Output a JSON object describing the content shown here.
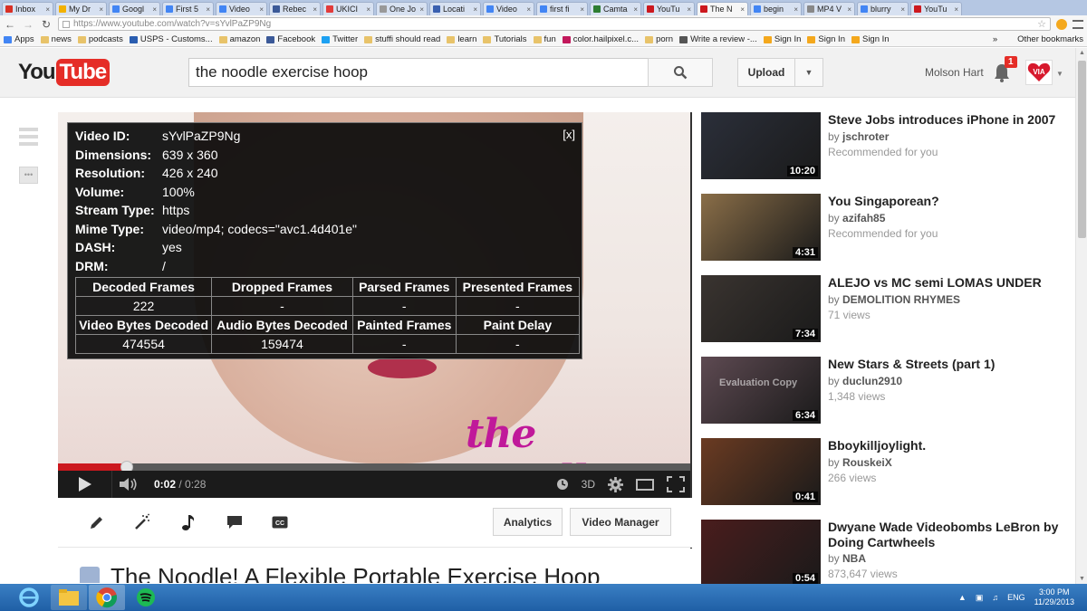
{
  "browser": {
    "tabs": [
      {
        "label": "Inbox",
        "color": "#d93025"
      },
      {
        "label": "My Dr",
        "color": "#f2b100"
      },
      {
        "label": "Googl",
        "color": "#4285f4"
      },
      {
        "label": "First 5",
        "color": "#4285f4"
      },
      {
        "label": "Video",
        "color": "#4285f4"
      },
      {
        "label": "Rebec",
        "color": "#3b5998"
      },
      {
        "label": "UKICI",
        "color": "#e23b3b"
      },
      {
        "label": "One Jo",
        "color": "#999999"
      },
      {
        "label": "Locati",
        "color": "#3a60b0"
      },
      {
        "label": "Video",
        "color": "#4285f4"
      },
      {
        "label": "first fi",
        "color": "#4285f4"
      },
      {
        "label": "Camta",
        "color": "#2e7d32"
      },
      {
        "label": "YouTu",
        "color": "#cc181e"
      },
      {
        "label": "The N",
        "color": "#cc181e",
        "active": true
      },
      {
        "label": "begin",
        "color": "#4285f4"
      },
      {
        "label": "MP4 V",
        "color": "#888888"
      },
      {
        "label": "blurry",
        "color": "#4285f4"
      },
      {
        "label": "YouTu",
        "color": "#cc181e"
      }
    ],
    "url": "https://www.youtube.com/watch?v=sYvlPaZP9Ng",
    "bookmarks": [
      "Apps",
      "news",
      "podcasts",
      "USPS - Customs...",
      "amazon",
      "Facebook",
      "Twitter",
      "stuffi should read",
      "learn",
      "Tutorials",
      "fun",
      "color.hailpixel.c...",
      "porn",
      "Write a review -...",
      "Sign In",
      "Sign In",
      "Sign In"
    ],
    "other_bookmarks": "Other bookmarks"
  },
  "header": {
    "logo_you": "You",
    "logo_tube": "Tube",
    "search_value": "the noodle exercise hoop",
    "upload_label": "Upload",
    "user_name": "Molson Hart",
    "notification_count": "1",
    "avatar_text": "VIA"
  },
  "player": {
    "current_time": "0:02",
    "duration": "/ 0:28",
    "progress_fraction": 0.108,
    "three_d_label": "3D",
    "watermark": "the noodle!"
  },
  "stats": {
    "close_label": "[x]",
    "rows": [
      {
        "k": "Video ID:",
        "v": "sYvlPaZP9Ng"
      },
      {
        "k": "Dimensions:",
        "v": "639 x 360"
      },
      {
        "k": "Resolution:",
        "v": "426 x 240"
      },
      {
        "k": "Volume:",
        "v": "100%"
      },
      {
        "k": "Stream Type:",
        "v": "https"
      },
      {
        "k": "Mime Type:",
        "v": "video/mp4; codecs=\"avc1.4d401e\""
      },
      {
        "k": "DASH:",
        "v": "yes"
      },
      {
        "k": "DRM:",
        "v": "/"
      }
    ],
    "table": [
      [
        "Decoded Frames",
        "Dropped Frames",
        "Parsed Frames",
        "Presented Frames"
      ],
      [
        "222",
        "-",
        "-",
        "-"
      ],
      [
        "Video Bytes Decoded",
        "Audio Bytes Decoded",
        "Painted Frames",
        "Paint Delay"
      ],
      [
        "474554",
        "159474",
        "-",
        "-"
      ]
    ]
  },
  "actions": {
    "analytics_label": "Analytics",
    "video_manager_label": "Video Manager"
  },
  "video_title": "The Noodle! A Flexible Portable Exercise Hoop",
  "related": [
    {
      "title": "Steve Jobs introduces iPhone in 2007",
      "by_prefix": "by ",
      "channel": "jschroter",
      "meta": "Recommended for you",
      "duration": "10:20",
      "thumb": "#2b2f3a"
    },
    {
      "title": "You Singaporean?",
      "by_prefix": "by ",
      "channel": "azifah85",
      "meta": "Recommended for you",
      "duration": "4:31",
      "thumb": "#8a6e48"
    },
    {
      "title": "ALEJO vs MC semi LOMAS UNDER",
      "by_prefix": "by ",
      "channel": "DEMOLITION RHYMES",
      "meta": "71 views",
      "duration": "7:34",
      "thumb": "#3a3430"
    },
    {
      "title": "New Stars & Streets (part 1)",
      "by_prefix": "by ",
      "channel": "duclun2910",
      "meta": "1,348 views",
      "duration": "6:34",
      "thumb": "#5e4a52",
      "watermark": "Evaluation Copy"
    },
    {
      "title": "Bboykilljoylight.",
      "by_prefix": "by ",
      "channel": "RouskeiX",
      "meta": "266 views",
      "duration": "0:41",
      "thumb": "#6b3b22"
    },
    {
      "title": "Dwyane Wade Videobombs LeBron by Doing Cartwheels",
      "by_prefix": "by ",
      "channel": "NBA",
      "meta": "873,647 views",
      "duration": "0:54",
      "thumb": "#4a1d1d"
    }
  ],
  "taskbar": {
    "lang": "ENG",
    "time": "3:00 PM",
    "date": "11/29/2013"
  }
}
